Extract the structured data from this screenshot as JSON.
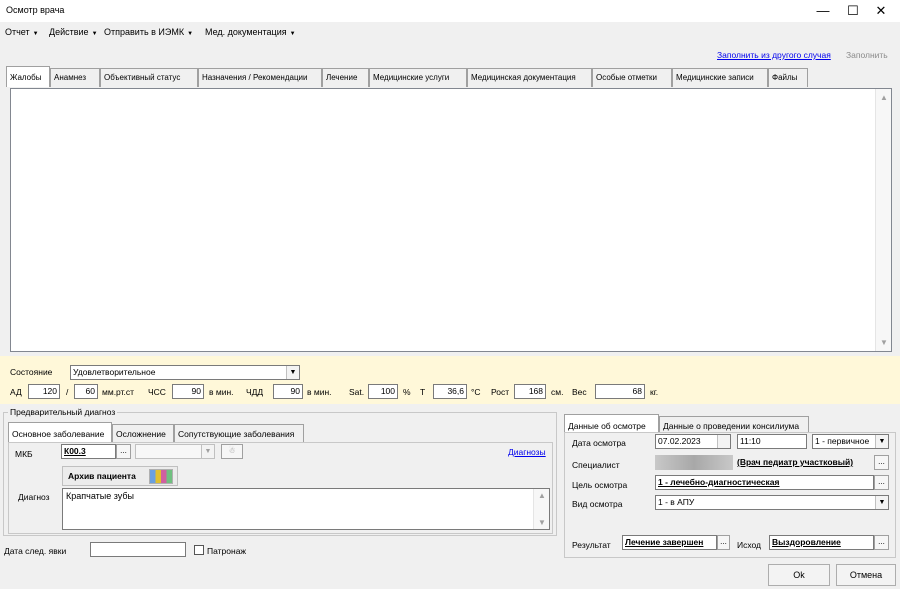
{
  "window": {
    "title": "Осмотр врача",
    "minimize": "—",
    "maximize": "☐",
    "close": "✕"
  },
  "menu": [
    {
      "label": "Отчет"
    },
    {
      "label": "Действие"
    },
    {
      "label": "Отправить в ИЭМК"
    },
    {
      "label": "Мед. документация"
    }
  ],
  "toplinks": {
    "fill_from_other": "Заполнить из другого случая",
    "fill": "Заполнить"
  },
  "tabs": [
    "Жалобы",
    "Анамнез",
    "Объективный статус",
    "Назначения / Рекомендации",
    "Лечение",
    "Медицинские услуги",
    "Медицинская документация",
    "Особые отметки",
    "Медицинские записи",
    "Файлы"
  ],
  "vitals": {
    "state_label": "Состояние",
    "state_value": "Удовлетворительное",
    "ad_label": "АД",
    "ad_sys": "120",
    "ad_sep": "/",
    "ad_dia": "60",
    "ad_unit": "мм.рт.ст",
    "hr_label": "ЧСС",
    "hr_value": "90",
    "hr_unit": "в мин.",
    "rr_label": "ЧДД",
    "rr_value": "90",
    "rr_unit": "в мин.",
    "sat_label": "Sat.",
    "sat_value": "100",
    "sat_unit": "%",
    "t_label": "Т",
    "t_value": "36,6",
    "t_unit": "°С",
    "height_label": "Рост",
    "height_value": "168",
    "height_unit": "см.",
    "weight_label": "Вес",
    "weight_value": "68",
    "weight_unit": "кг."
  },
  "prelim": {
    "legend": "Предварительный диагноз",
    "tabs": [
      "Основное заболевание",
      "Осложнение",
      "Сопутствующие заболевания"
    ],
    "mkb_label": "МКБ",
    "mkb_value": "К00.3",
    "diagnoses_link": "Диагнозы",
    "archive_button": "Архив пациента",
    "diagnosis_label": "Диагноз",
    "diagnosis_value": "Крапчатые зубы"
  },
  "next_visit": {
    "label": "Дата след. явки",
    "value": "",
    "patronage_label": "Патронаж"
  },
  "exam": {
    "tabs": [
      "Данные об осмотре",
      "Данные о проведении консилиума"
    ],
    "date_label": "Дата осмотра",
    "date_value": "07.02.2023",
    "time_value": "11:10",
    "type_value": "1 - первичное",
    "specialist_label": "Специалист",
    "specialist_value": "(Врач педиатр участковый)",
    "purpose_label": "Цель осмотра",
    "purpose_value": "1 - лечебно-диагностическая",
    "kind_label": "Вид осмотра",
    "kind_value": "1 - в АПУ",
    "result_label": "Результат",
    "result_value": "Лечение завершен",
    "outcome_label": "Исход",
    "outcome_value": "Выздоровление"
  },
  "buttons": {
    "ok": "Ok",
    "cancel": "Отмена"
  }
}
